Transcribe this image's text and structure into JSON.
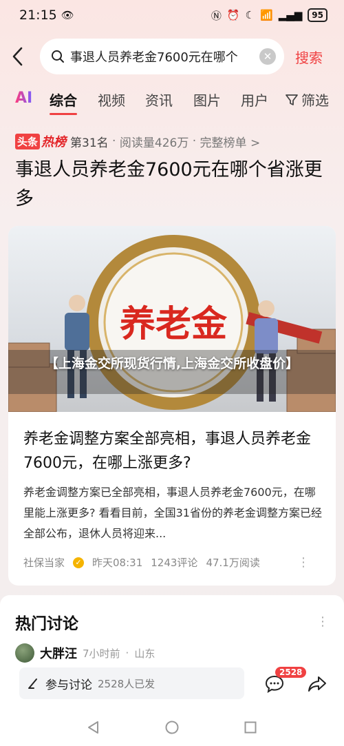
{
  "status_bar": {
    "time": "21:15",
    "battery": "95"
  },
  "search": {
    "query": "事退人员养老金7600元在哪个",
    "submit_label": "搜索"
  },
  "tabs": [
    {
      "label": "AI"
    },
    {
      "label": "综合"
    },
    {
      "label": "视频"
    },
    {
      "label": "资讯"
    },
    {
      "label": "图片"
    },
    {
      "label": "用户"
    }
  ],
  "filter_label": "筛选",
  "hot_rank": {
    "brand": "头条",
    "brand_suffix": "热榜",
    "rank": "第31名",
    "reads": "阅读量426万",
    "full_list": "完整榜单 >"
  },
  "headline": "事退人员养老金7600元在哪个省涨更多",
  "article": {
    "image_text": "养老金",
    "image_caption": "【上海金交所现货行情,上海金交所收盘价】",
    "title": "养老金调整方案全部亮相，事退人员养老金7600元，在哪上涨更多?",
    "summary": "养老金调整方案已全部亮相，事退人员养老金7600元，在哪里能上涨更多? 看看目前，全国31省份的养老金调整方案已经全部公布，退休人员将迎来...",
    "source": "社保当家",
    "time": "昨天08:31",
    "comments": "1243评论",
    "reads": "47.1万阅读"
  },
  "discussion": {
    "title": "热门讨论",
    "user": {
      "name": "大胖汪",
      "time": "7小时前",
      "location": "山东"
    },
    "join_label": "参与讨论",
    "join_count": "2528人已发",
    "comment_badge": "2528"
  },
  "colors": {
    "accent": "#f04142"
  }
}
